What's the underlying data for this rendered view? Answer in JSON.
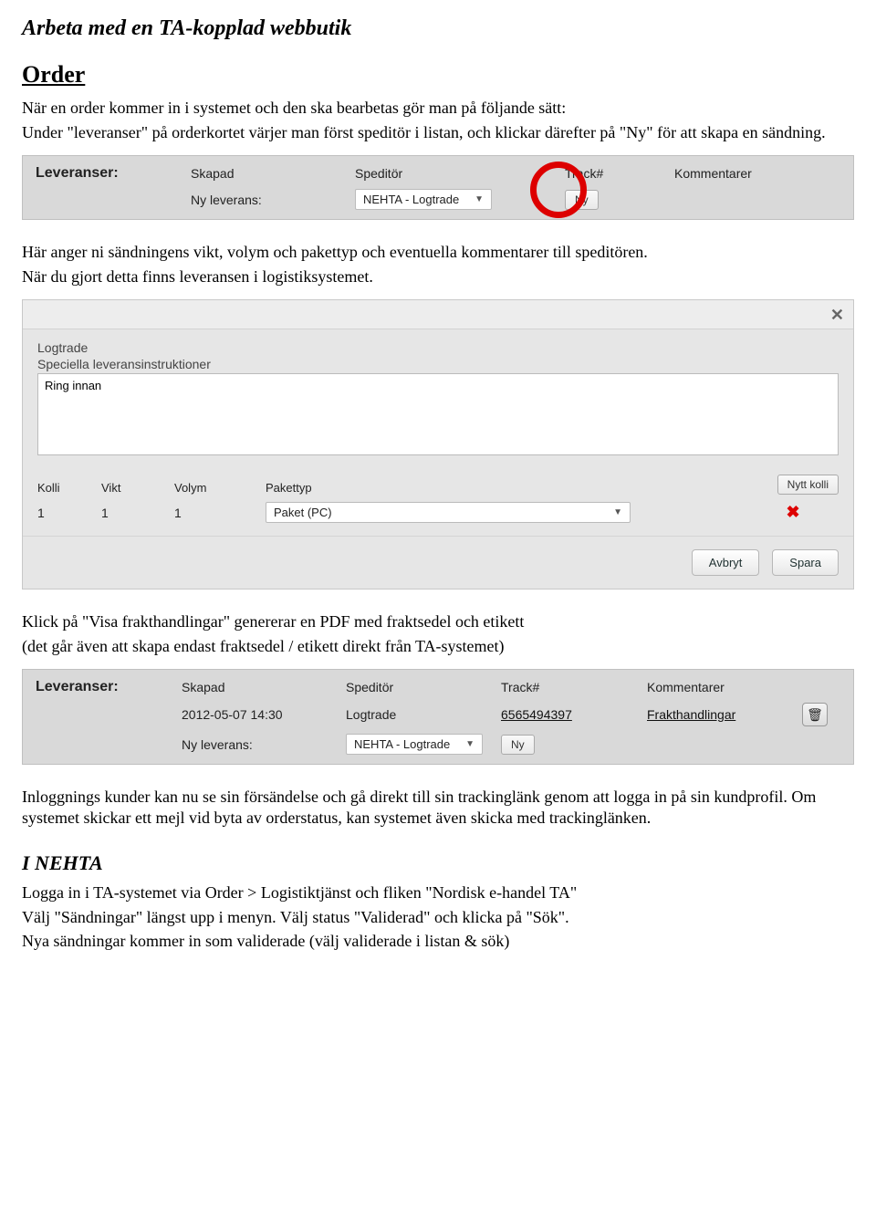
{
  "doc": {
    "title": "Arbeta med en TA-kopplad webbutik",
    "order_h": "Order",
    "intro1": "När en order kommer in i systemet och den ska bearbetas gör man på följande sätt:",
    "intro2": "Under \"leveranser\" på orderkortet värjer man först speditör i listan, och klickar därefter på \"Ny\" för att skapa en sändning.",
    "mid1": "Här anger ni sändningens vikt, volym och pakettyp och eventuella kommentarer till speditören.",
    "mid2": "När du gjort detta finns leveransen i logistiksystemet.",
    "aftDlg1": "Klick på \"Visa frakthandlingar\" genererar en PDF med fraktsedel och etikett",
    "aftDlg2": "(det går även att skapa endast fraktsedel / etikett direkt från TA-systemet)",
    "ending1": "Inloggnings kunder kan nu se sin försändelse och gå direkt till sin trackinglänk  genom att logga in på sin kundprofil. Om systemet skickar ett mejl vid byta av orderstatus, kan systemet även skicka med trackinglänken.",
    "nehta_h": "I NEHTA",
    "nehta1": "Logga in i TA-systemet via Order > Logistiktjänst och fliken \"Nordisk e-handel TA\"",
    "nehta2": "Välj \"Sändningar\" längst upp i menyn. Välj status \"Validerad\" och klicka på \"Sök\".",
    "nehta3": "Nya sändningar kommer in som validerade (välj validerade i listan & sök)"
  },
  "panel1": {
    "header": "Leveranser:",
    "cols": {
      "skapad": "Skapad",
      "speditor": "Speditör",
      "track": "Track#",
      "kommentar": "Kommentarer"
    },
    "ny_leverans": "Ny leverans:",
    "dropdown": "NEHTA - Logtrade",
    "ny_btn": "Ny"
  },
  "panel2": {
    "title": "Logtrade",
    "instr_label": "Speciella leveransinstruktioner",
    "instr_value": "Ring innan",
    "cols": {
      "kolli": "Kolli",
      "vikt": "Vikt",
      "volym": "Volym",
      "pakettyp": "Pakettyp"
    },
    "nytt_kolli": "Nytt kolli",
    "row": {
      "kolli": "1",
      "vikt": "1",
      "volym": "1",
      "pakettyp": "Paket (PC)"
    },
    "avbryt": "Avbryt",
    "spara": "Spara"
  },
  "panel3": {
    "header": "Leveranser:",
    "cols": {
      "skapad": "Skapad",
      "speditor": "Speditör",
      "track": "Track#",
      "kommentar": "Kommentarer"
    },
    "row": {
      "skapad": "2012-05-07 14:30",
      "speditor": "Logtrade",
      "track": "6565494397",
      "kommentar": "Frakthandlingar"
    },
    "ny_leverans": "Ny leverans:",
    "dropdown": "NEHTA - Logtrade",
    "ny_btn": "Ny"
  }
}
